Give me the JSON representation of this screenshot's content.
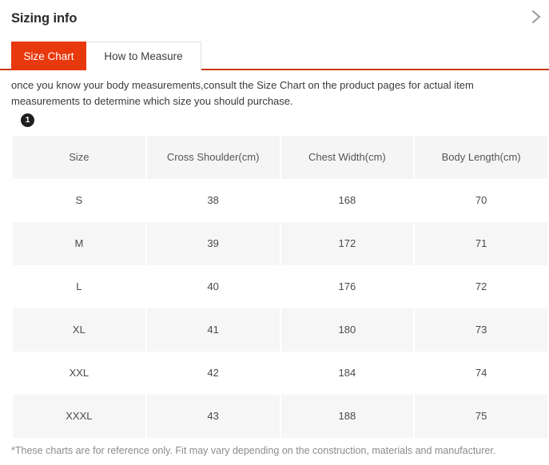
{
  "header": {
    "title": "Sizing info",
    "chevron_icon": "chevron-right-icon"
  },
  "tabs": [
    {
      "label": "Size Chart",
      "active": true
    },
    {
      "label": "How to Measure",
      "active": false
    }
  ],
  "intro": {
    "text": "once you know your body measurements,consult the Size Chart on the product pages for actual item measurements to determine which size you should purchase.",
    "step_badge": "1"
  },
  "table": {
    "columns": [
      "Size",
      "Cross Shoulder(cm)",
      "Chest Width(cm)",
      "Body Length(cm)"
    ],
    "rows": [
      [
        "S",
        "38",
        "168",
        "70"
      ],
      [
        "M",
        "39",
        "172",
        "71"
      ],
      [
        "L",
        "40",
        "176",
        "72"
      ],
      [
        "XL",
        "41",
        "180",
        "73"
      ],
      [
        "XXL",
        "42",
        "184",
        "74"
      ],
      [
        "XXXL",
        "43",
        "188",
        "75"
      ]
    ]
  },
  "footnote": {
    "text": "*These charts are for reference only. Fit may vary depending on the construction, materials and manufacturer."
  },
  "colors": {
    "accent": "#e8380d",
    "accent_rule": "#c8391a",
    "cell_shade": "#f6f6f6",
    "header_shade": "#f5f5f5",
    "badge": "#1f1f1f"
  }
}
